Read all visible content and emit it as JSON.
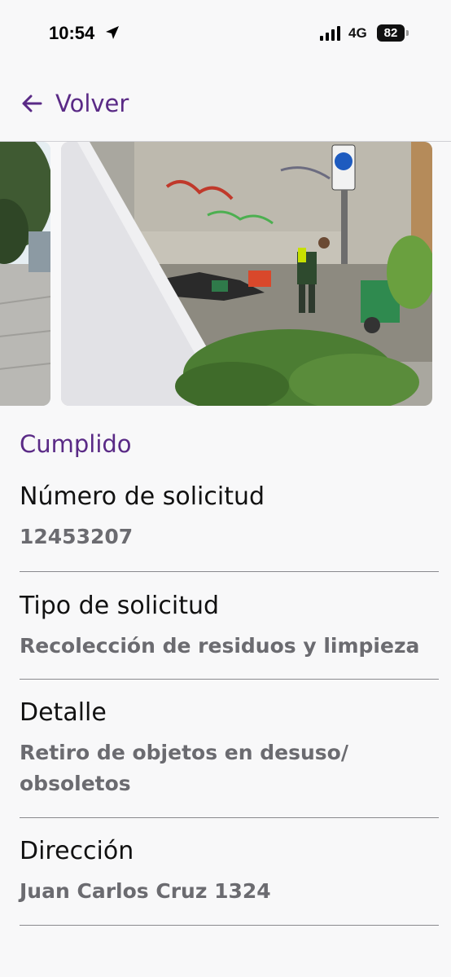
{
  "status_bar": {
    "time": "10:54",
    "network": "4G",
    "battery": "82"
  },
  "header": {
    "back_label": "Volver"
  },
  "gallery": {
    "images": [
      "street-photo",
      "cleanup-photo"
    ]
  },
  "request": {
    "status": "Cumplido",
    "fields": [
      {
        "label": "Número de solicitud",
        "value": "12453207"
      },
      {
        "label": "Tipo de solicitud",
        "value": "Recolección de residuos y limpieza"
      },
      {
        "label": "Detalle",
        "value": "Retiro de objetos en desuso/ obsoletos"
      },
      {
        "label": "Dirección",
        "value": "Juan Carlos Cruz 1324"
      }
    ]
  },
  "colors": {
    "accent": "#5a2a86",
    "background": "#f8f8f9",
    "value_text": "#6b6b70"
  }
}
